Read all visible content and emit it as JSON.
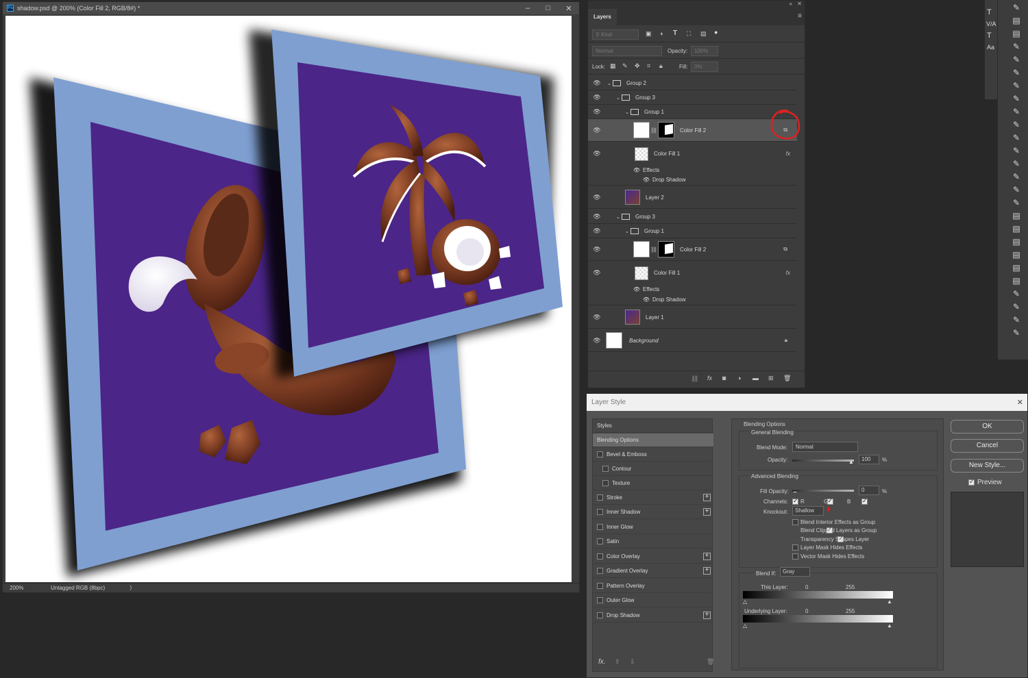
{
  "document": {
    "title": "shadow.psd @ 200% (Color Fill 2, RGB/8#) *",
    "app_icon": "Ps",
    "controls": [
      "–",
      "□",
      "✕"
    ],
    "status_zoom": "200%",
    "status_info": "Untagged RGB (8bpc)",
    "status_arrow": "〉"
  },
  "layers_panel": {
    "tab": "Layers",
    "kind_placeholder": "Kind",
    "blend_mode": "Normal",
    "opacity_label": "Opacity:",
    "opacity_value": "100%",
    "lock_label": "Lock:",
    "fill_label": "Fill:",
    "fill_value": "0%",
    "rows": [
      {
        "label": "Group 2",
        "type": "group",
        "indent": 0
      },
      {
        "label": "Group 3",
        "type": "group",
        "indent": 1
      },
      {
        "label": "Group 1",
        "type": "group",
        "indent": 2
      },
      {
        "label": "Color Fill 2",
        "type": "fill",
        "selected": true
      },
      {
        "label": "Color Fill 1",
        "type": "checker",
        "fx": "fx"
      },
      {
        "label": "Effects",
        "type": "effects"
      },
      {
        "label": "Drop Shadow",
        "type": "effect"
      },
      {
        "label": "Layer 2",
        "type": "image"
      },
      {
        "label": "Group 3",
        "type": "group",
        "indent": 1
      },
      {
        "label": "Group 1",
        "type": "group",
        "indent": 2
      },
      {
        "label": "Color Fill 2",
        "type": "fill"
      },
      {
        "label": "Color Fill 1",
        "type": "checker",
        "fx": "fx"
      },
      {
        "label": "Effects",
        "type": "effects"
      },
      {
        "label": "Drop Shadow",
        "type": "effect"
      },
      {
        "label": "Layer 1",
        "type": "image"
      },
      {
        "label": "Background",
        "type": "background"
      }
    ]
  },
  "layer_style": {
    "title": "Layer Style",
    "close": "✕",
    "styles_header": "Styles",
    "styles": [
      {
        "label": "Blending Options",
        "active": true
      },
      {
        "label": "Bevel & Emboss",
        "checkbox": true
      },
      {
        "label": "Contour",
        "checkbox": true,
        "sub": true
      },
      {
        "label": "Texture",
        "checkbox": true,
        "sub": true
      },
      {
        "label": "Stroke",
        "checkbox": true,
        "plus": true
      },
      {
        "label": "Inner Shadow",
        "checkbox": true,
        "plus": true
      },
      {
        "label": "Inner Glow",
        "checkbox": true
      },
      {
        "label": "Satin",
        "checkbox": true
      },
      {
        "label": "Color Overlay",
        "checkbox": true,
        "plus": true
      },
      {
        "label": "Gradient Overlay",
        "checkbox": true,
        "plus": true
      },
      {
        "label": "Pattern Overlay",
        "checkbox": true
      },
      {
        "label": "Outer Glow",
        "checkbox": true
      },
      {
        "label": "Drop Shadow",
        "checkbox": true,
        "plus": true
      }
    ],
    "blending_options": "Blending Options",
    "general_blending": "General Blending",
    "blend_mode_label": "Blend Mode:",
    "blend_mode_value": "Normal",
    "opacity_label": "Opacity:",
    "opacity_value": "100",
    "percent": "%",
    "advanced_blending": "Advanced Blending",
    "fill_opacity_label": "Fill Opacity:",
    "fill_opacity_value": "0",
    "channels_label": "Channels:",
    "channels": [
      "R",
      "G",
      "B"
    ],
    "knockout_label": "Knockout:",
    "knockout_value": "Shallow",
    "options": [
      {
        "label": "Blend Interior Effects as Group",
        "checked": false
      },
      {
        "label": "Blend Clipped Layers as Group",
        "checked": true
      },
      {
        "label": "Transparency Shapes Layer",
        "checked": true
      },
      {
        "label": "Layer Mask Hides Effects",
        "checked": false
      },
      {
        "label": "Vector Mask Hides Effects",
        "checked": false
      }
    ],
    "blend_if_label": "Blend If:",
    "blend_if_value": "Gray",
    "this_layer": "This Layer:",
    "underlying_layer": "Underlying Layer:",
    "range_min": "0",
    "range_max": "255",
    "buttons": {
      "ok": "OK",
      "cancel": "Cancel",
      "new_style": "New Style...",
      "preview": "Preview"
    },
    "footer_fx": "fx."
  },
  "colors": {
    "frame": "#7f9fd1",
    "purple": "#4b2588",
    "chocolate": "#7a3b22",
    "annotation_red": "#e02020"
  }
}
